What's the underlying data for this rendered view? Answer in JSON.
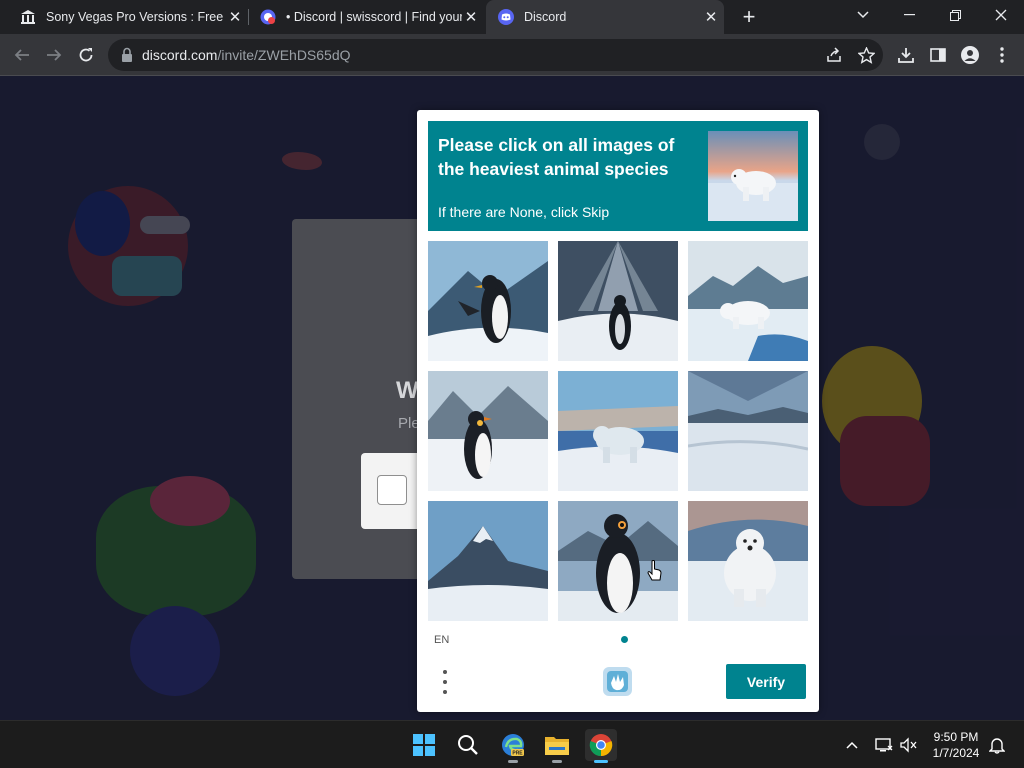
{
  "browser": {
    "tabs": [
      {
        "title": "Sony Vegas Pro Versions : Free D",
        "icon": "museum-icon",
        "active": false
      },
      {
        "title": "• Discord | swisscord | Find your c",
        "icon": "discord-invite-icon",
        "active": false
      },
      {
        "title": "Discord",
        "icon": "discord-icon",
        "active": true
      }
    ],
    "new_tab_label": "+",
    "address": {
      "host": "discord.com",
      "path": "/invite/ZWEhDS65dQ"
    }
  },
  "page": {
    "heading_partial": "W",
    "subtext_partial": "Ple"
  },
  "challenge": {
    "prompt": "Please click on all images of the heaviest animal species",
    "hint": "If there are None, click Skip",
    "prompt_image": "polar-bear",
    "grid": [
      {
        "subject": "penguin",
        "name": "image-penguin-rock"
      },
      {
        "subject": "penguin",
        "name": "image-penguin-sunbeams"
      },
      {
        "subject": "polar-bear",
        "name": "image-polar-bear-iceberg"
      },
      {
        "subject": "penguin",
        "name": "image-penguin-mountains"
      },
      {
        "subject": "polar-bear",
        "name": "image-polar-bear-walking"
      },
      {
        "subject": "landscape",
        "name": "image-snowy-landscape"
      },
      {
        "subject": "landscape",
        "name": "image-snowy-mountain"
      },
      {
        "subject": "penguin",
        "name": "image-penguin-closeup"
      },
      {
        "subject": "polar-bear",
        "name": "image-polar-bear-sitting"
      }
    ],
    "language": "EN",
    "verify_label": "Verify",
    "accent_color": "#00838f"
  },
  "taskbar": {
    "apps": [
      "windows-start",
      "search",
      "edge-beta",
      "file-explorer",
      "chrome"
    ],
    "time": "9:50 PM",
    "date": "1/7/2024"
  }
}
